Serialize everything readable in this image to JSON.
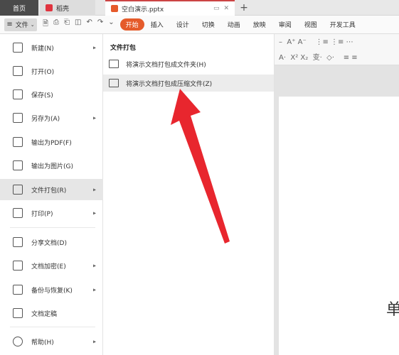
{
  "tabs": {
    "home": "首页",
    "docer": "稻壳",
    "document": "空白演示.pptx",
    "add": "+"
  },
  "menubar": {
    "file": "文件",
    "items": [
      "开始",
      "插入",
      "设计",
      "切换",
      "动画",
      "放映",
      "审阅",
      "视图",
      "开发工具"
    ],
    "active_index": 0
  },
  "file_menu": {
    "items": [
      {
        "label": "新建(N)",
        "icon": "new-file-icon",
        "has_arrow": true
      },
      {
        "label": "打开(O)",
        "icon": "folder-open-icon",
        "has_arrow": false
      },
      {
        "label": "保存(S)",
        "icon": "save-icon",
        "has_arrow": false
      },
      {
        "label": "另存为(A)",
        "icon": "save-as-icon",
        "has_arrow": true
      },
      {
        "label": "输出为PDF(F)",
        "icon": "pdf-icon",
        "has_arrow": false
      },
      {
        "label": "输出为图片(G)",
        "icon": "image-icon",
        "has_arrow": false
      },
      {
        "label": "文件打包(R)",
        "icon": "package-icon",
        "has_arrow": true
      },
      {
        "label": "打印(P)",
        "icon": "print-icon",
        "has_arrow": true
      },
      {
        "label": "分享文档(D)",
        "icon": "share-icon",
        "has_arrow": false
      },
      {
        "label": "文档加密(E)",
        "icon": "encrypt-icon",
        "has_arrow": true
      },
      {
        "label": "备份与恢复(K)",
        "icon": "backup-icon",
        "has_arrow": true
      },
      {
        "label": "文档定稿",
        "icon": "finalize-icon",
        "has_arrow": false
      },
      {
        "label": "帮助(H)",
        "icon": "help-icon",
        "has_arrow": true
      }
    ],
    "selected_index": 6
  },
  "submenu": {
    "title": "文件打包",
    "items": [
      {
        "label": "将演示文档打包成文件夹(H)"
      },
      {
        "label": "将演示文档打包成压缩文件(Z)"
      }
    ],
    "hover_index": 1
  },
  "document": {
    "visible_char": "单"
  },
  "colors": {
    "accent": "#e55b2b",
    "arrow": "#e8262e",
    "home_tab": "#4a4a4a"
  }
}
